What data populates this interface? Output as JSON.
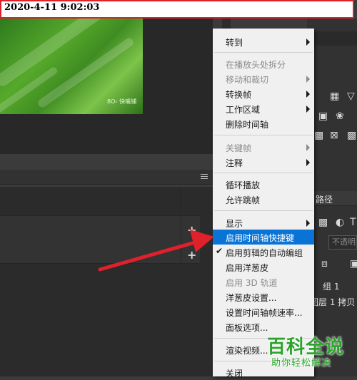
{
  "timestamp": "2020-4-11 9:02:03",
  "video": {
    "watermark": "8O‹ 快嘴铺"
  },
  "context_menu": {
    "items": [
      {
        "label": "转到",
        "enabled": true,
        "submenu": true
      },
      {
        "label": "在播放头处拆分",
        "enabled": false,
        "submenu": false
      },
      {
        "label": "移动和裁切",
        "enabled": false,
        "submenu": true
      },
      {
        "label": "转换帧",
        "enabled": true,
        "submenu": true
      },
      {
        "label": "工作区域",
        "enabled": true,
        "submenu": true
      },
      {
        "label": "删除时间轴",
        "enabled": true,
        "submenu": false
      },
      {
        "label": "关键帧",
        "enabled": false,
        "submenu": true
      },
      {
        "label": "注释",
        "enabled": true,
        "submenu": true
      },
      {
        "label": "循环播放",
        "enabled": true,
        "submenu": false
      },
      {
        "label": "允许跳帧",
        "enabled": true,
        "submenu": false
      },
      {
        "label": "显示",
        "enabled": true,
        "submenu": true
      },
      {
        "label": "启用时间轴快捷键",
        "enabled": true,
        "highlighted": true
      },
      {
        "label": "启用剪辑的自动编组",
        "enabled": true,
        "checked": true
      },
      {
        "label": "启用洋葱皮",
        "enabled": true
      },
      {
        "label": "启用 3D 轨道",
        "enabled": false
      },
      {
        "label": "洋葱皮设置...",
        "enabled": true
      },
      {
        "label": "设置时间轴帧速率...",
        "enabled": true
      },
      {
        "label": "面板选项...",
        "enabled": true
      },
      {
        "label": "渲染视频...",
        "enabled": true
      },
      {
        "label": "关闭",
        "enabled": true
      }
    ]
  },
  "right_panel": {
    "path_tab": "路径",
    "opacity_placeholder": "不透明",
    "layer_line_1": "组 1",
    "layer_line_2": "图层 1 拷贝"
  },
  "timeline": {
    "add_track": "+"
  },
  "brand": {
    "title": "百科全说",
    "subtitle": "助你轻松解决"
  },
  "colors": {
    "highlight": "#0a74d6",
    "annotation_red": "#e0202a",
    "brand_green": "#2aa52a"
  }
}
